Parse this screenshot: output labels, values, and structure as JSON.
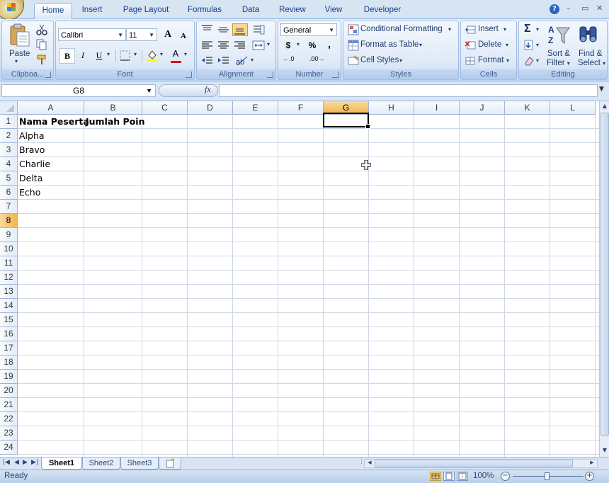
{
  "ribbon_tabs": [
    "Home",
    "Insert",
    "Page Layout",
    "Formulas",
    "Data",
    "Review",
    "View",
    "Developer"
  ],
  "active_tab": "Home",
  "window_controls": {
    "help": "?",
    "minimize": "–",
    "restore": "▭",
    "close": "✕"
  },
  "clipboard": {
    "paste": "Paste",
    "label": "Clipboa..."
  },
  "font": {
    "name": "Calibri",
    "size": "11",
    "grow": "A",
    "shrink": "A",
    "bold": "B",
    "italic": "I",
    "underline": "U",
    "color_letter": "A",
    "label": "Font"
  },
  "alignment": {
    "label": "Alignment"
  },
  "number": {
    "format": "General",
    "currency": "$",
    "percent": "%",
    "comma": ",",
    "inc_decimal": ".0",
    "dec_decimal": ".00",
    "label": "Number"
  },
  "styles": {
    "conditional": "Conditional Formatting",
    "format_table": "Format as Table",
    "cell_styles": "Cell Styles",
    "label": "Styles"
  },
  "cells": {
    "insert": "Insert",
    "delete": "Delete",
    "format": "Format",
    "label": "Cells"
  },
  "editing": {
    "sigma": "Σ",
    "sort_line1": "Sort &",
    "sort_line2": "Filter",
    "find_line1": "Find &",
    "find_line2": "Select",
    "label": "Editing"
  },
  "formula_bar": {
    "name_box": "G8",
    "fx": "fx",
    "value": ""
  },
  "columns": [
    "A",
    "B",
    "C",
    "D",
    "E",
    "F",
    "G",
    "H",
    "I",
    "J",
    "K",
    "L"
  ],
  "rows": [
    "1",
    "2",
    "3",
    "4",
    "5",
    "6",
    "7",
    "8",
    "9",
    "10",
    "11",
    "12",
    "13",
    "14",
    "15",
    "16",
    "17",
    "18",
    "19",
    "20",
    "21",
    "22",
    "23",
    "24"
  ],
  "cells_data": {
    "A1": "Nama Peserta",
    "B1": "Jumlah Poin",
    "A2": "Alpha",
    "A3": "Bravo",
    "A4": "Charlie",
    "A5": "Delta",
    "A6": "Echo"
  },
  "selected_cell": "G8",
  "sheets": [
    "Sheet1",
    "Sheet2",
    "Sheet3"
  ],
  "active_sheet": "Sheet1",
  "status": {
    "ready": "Ready",
    "zoom": "100%",
    "zoom_out": "−",
    "zoom_in": "+"
  }
}
